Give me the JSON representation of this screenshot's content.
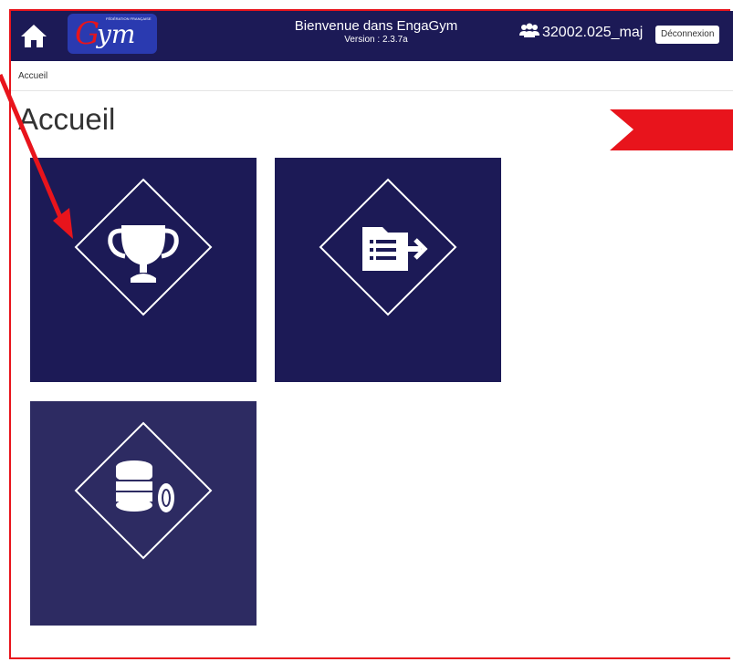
{
  "header": {
    "home_icon": "home-icon",
    "logo_text_g": "G",
    "logo_text_ym": "ym",
    "logo_small_text": "FÉDÉRATION FRANÇAISE",
    "welcome": "Bienvenue dans EngaGym",
    "version": "Version : 2.3.7a",
    "user_icon": "users-icon",
    "username": "32002.025_maj",
    "logout_label": "Déconnexion",
    "bg_color": "#1c1a56"
  },
  "breadcrumb": {
    "current": "Accueil"
  },
  "page": {
    "title": "Accueil"
  },
  "tiles": [
    {
      "icon": "trophy-icon"
    },
    {
      "icon": "file-export-icon"
    },
    {
      "icon": "coins-icon"
    }
  ],
  "annotations": {
    "color": "#e8141c"
  }
}
